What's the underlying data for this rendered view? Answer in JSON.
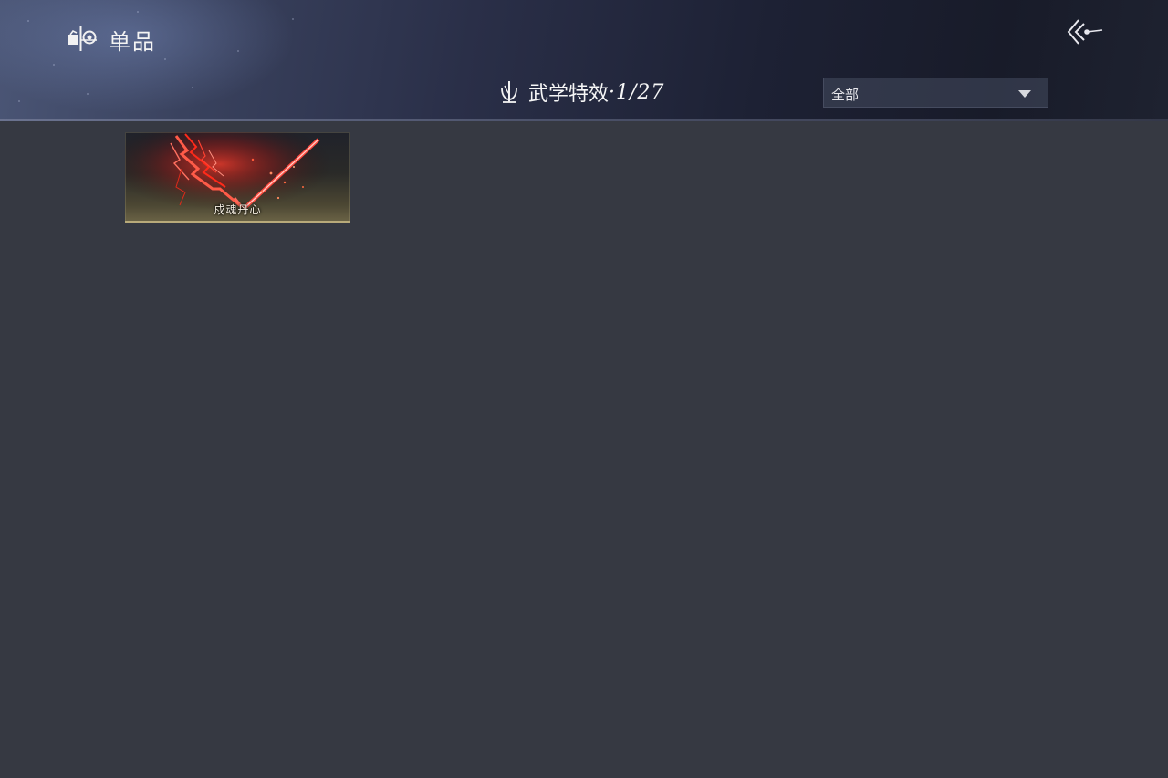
{
  "header": {
    "app_title": "单品",
    "back_icon": "back-arrow-icon"
  },
  "section": {
    "title": "武学特效",
    "count": "·1/27"
  },
  "filter": {
    "selected": "全部"
  },
  "items": [
    {
      "name": "戍魂丹心",
      "theme_color": "#d01818"
    }
  ],
  "colors": {
    "background": "#363942",
    "header_dark": "#1d2134",
    "accent_red": "#e02020"
  }
}
